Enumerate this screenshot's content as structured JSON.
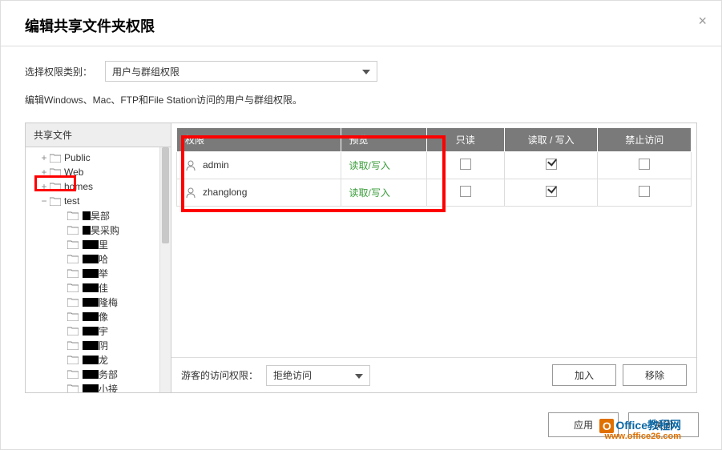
{
  "dialog": {
    "title": "编辑共享文件夹权限",
    "close_label": "×"
  },
  "category": {
    "label": "选择权限类别：",
    "selected": "用户与群组权限"
  },
  "description": "编辑Windows、Mac、FTP和File Station访问的用户与群组权限。",
  "tree": {
    "header": "共享文件",
    "items": [
      {
        "label": "Public",
        "level": 0,
        "redact_w": 0
      },
      {
        "label": "Web",
        "level": 0,
        "redact_w": 0
      },
      {
        "label": "homes",
        "level": 0,
        "redact_w": 0
      },
      {
        "label": "test",
        "level": 0,
        "redact_w": 0,
        "selected": true
      },
      {
        "label": "",
        "suffix": "昊部",
        "level": 1,
        "redact_w": 10
      },
      {
        "label": "",
        "suffix": "昊采购",
        "level": 1,
        "redact_w": 10
      },
      {
        "label": "",
        "suffix": "里",
        "level": 1,
        "redact_w": 20
      },
      {
        "label": "",
        "suffix": "哈",
        "level": 1,
        "redact_w": 20
      },
      {
        "label": "",
        "suffix": "举",
        "level": 1,
        "redact_w": 20
      },
      {
        "label": "",
        "suffix": "佳",
        "level": 1,
        "redact_w": 20
      },
      {
        "label": "",
        "suffix": "隆梅",
        "level": 1,
        "redact_w": 20
      },
      {
        "label": "",
        "suffix": "像",
        "level": 1,
        "redact_w": 20
      },
      {
        "label": "",
        "suffix": "宇",
        "level": 1,
        "redact_w": 20
      },
      {
        "label": "",
        "suffix": "阴",
        "level": 1,
        "redact_w": 20
      },
      {
        "label": "",
        "suffix": "龙",
        "level": 1,
        "redact_w": 20
      },
      {
        "label": "",
        "suffix": "务部",
        "level": 1,
        "redact_w": 20
      },
      {
        "label": "",
        "suffix": "小接",
        "level": 1,
        "redact_w": 20
      }
    ]
  },
  "table": {
    "headers": {
      "perm": "权限",
      "preview": "预览",
      "ro": "只读",
      "rw": "读取 / 写入",
      "deny": "禁止访问"
    },
    "rows": [
      {
        "name": "admin",
        "preview": "读取/写入",
        "ro": false,
        "rw": true,
        "deny": false
      },
      {
        "name": "zhanglong",
        "preview": "读取/写入",
        "ro": false,
        "rw": true,
        "deny": false
      }
    ]
  },
  "guest": {
    "label": "游客的访问权限：",
    "selected": "拒绝访问"
  },
  "buttons": {
    "add": "加入",
    "remove": "移除",
    "apply": "应用",
    "close": "关闭"
  },
  "watermark": {
    "title": "Office教程网",
    "url": "www.office26.com"
  }
}
